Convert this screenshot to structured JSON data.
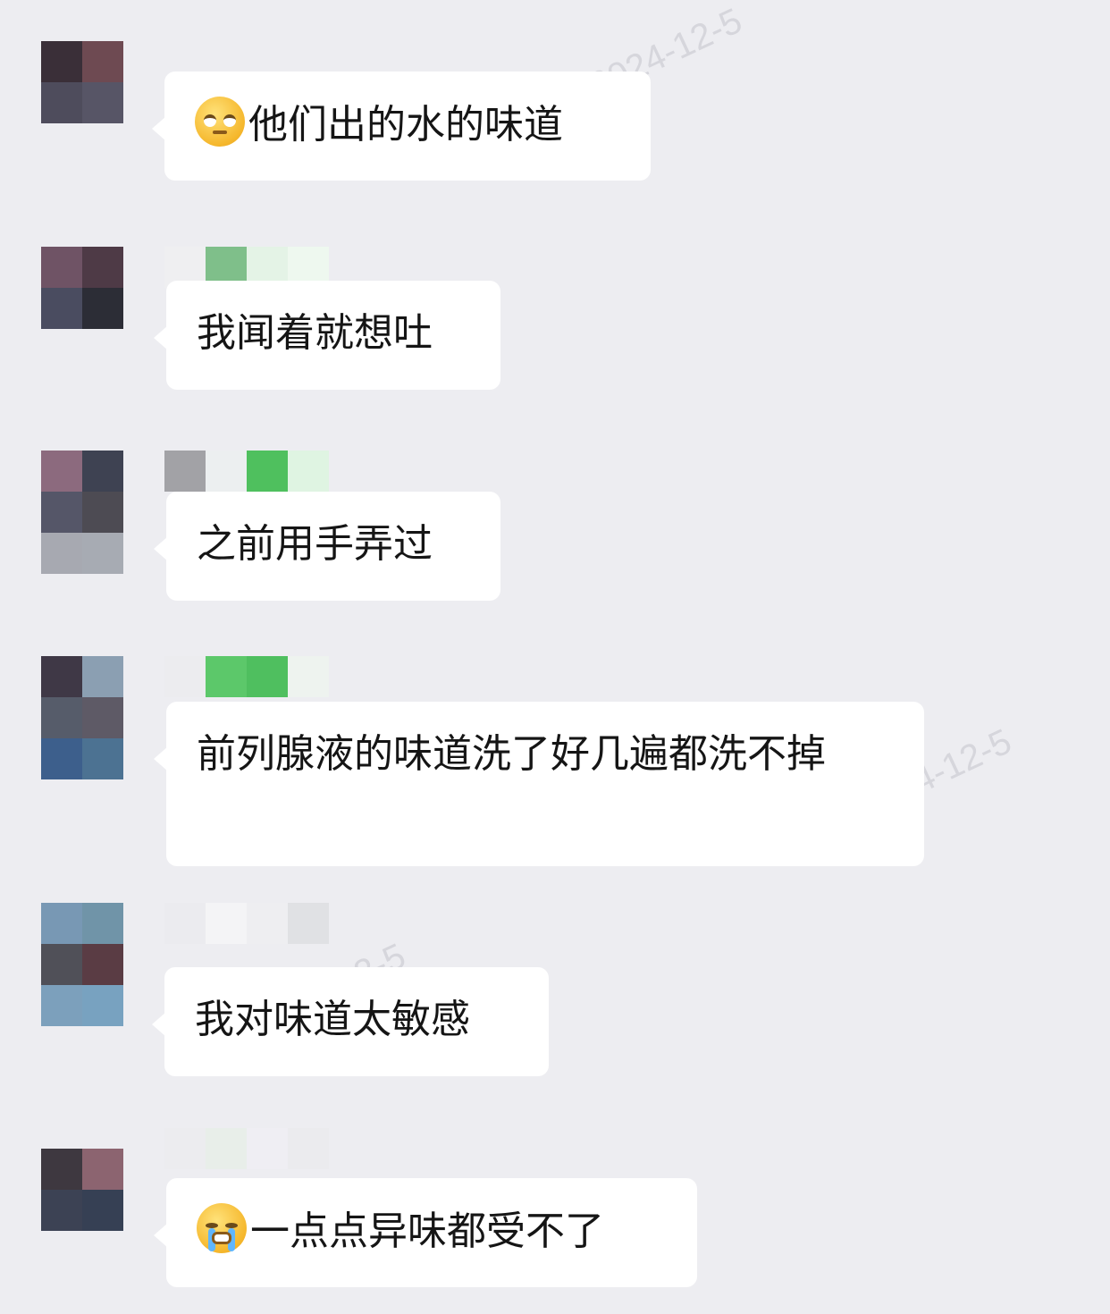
{
  "watermark": {
    "date_text": "2024-12-5",
    "partial_1": "4-12-5",
    "partial_2": "4-12-5"
  },
  "messages": [
    {
      "emoji": "rolling-eyes-emoji",
      "text": "他们出的水的味道",
      "avatar_colors": [
        "#3a2f38",
        "#6e4a52",
        "#4e4c5c",
        "#575566"
      ],
      "sender_blocks": []
    },
    {
      "emoji": "",
      "text": "我闻着就想吐",
      "avatar_colors": [
        "#6f5365",
        "#4e3a46",
        "#4a4c60",
        "#2c2d36"
      ],
      "sender_blocks": [
        "#efeff1",
        "#7fbf8a",
        "#e4f3e6",
        "#eef8ef"
      ]
    },
    {
      "emoji": "",
      "text": "之前用手弄过",
      "avatar_colors": [
        "#8c6a7e",
        "#3e4252",
        "#555668",
        "#4d4b53",
        "#a7a9b1",
        "#a7abb3"
      ],
      "sender_blocks": [
        "#a2a2a6",
        "#eceff0",
        "#4fc05e",
        "#dff4e2"
      ]
    },
    {
      "emoji": "",
      "text": "前列腺液的味道洗了好几遍都洗不掉",
      "avatar_colors": [
        "#3f3846",
        "#8b9fb2",
        "#565c6a",
        "#5e5a66",
        "#3d5f8c",
        "#4c7292"
      ],
      "sender_blocks": [
        "#ececef",
        "#5cc86a",
        "#4fbf5f",
        "#eef3ef"
      ]
    },
    {
      "emoji": "",
      "text": "我对味道太敏感",
      "avatar_colors": [
        "#7898b4",
        "#7094a8",
        "#505058",
        "#5a3c44",
        "#7ca0bc",
        "#78a2c0"
      ],
      "sender_blocks": [
        "#ebebef",
        "#f4f4f6",
        "#eeeef1",
        "#e0e1e4"
      ]
    },
    {
      "emoji": "crying-emoji",
      "text": "一点点异味都受不了",
      "avatar_colors": [
        "#3e3840",
        "#8c6470",
        "#3c4254",
        "#364054"
      ],
      "sender_blocks": [
        "#ececef",
        "#e8eee9",
        "#efeef3",
        "#ebebee"
      ]
    }
  ]
}
